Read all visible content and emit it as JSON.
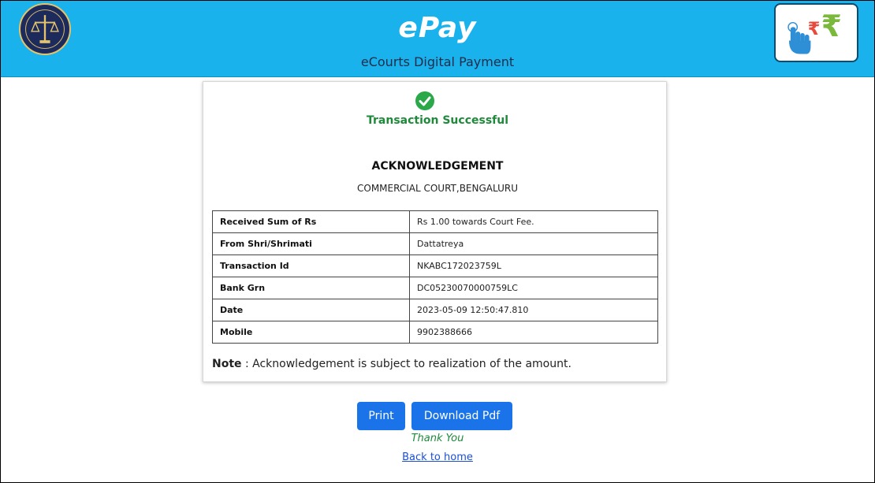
{
  "header": {
    "title": "ePay",
    "subtitle": "eCourts Digital Payment",
    "logo_icon": "court-emblem-icon",
    "pay_icon": "touch-rupee-icon"
  },
  "receipt": {
    "status_icon": "check-circle-icon",
    "status_text": "Transaction Successful",
    "heading": "ACKNOWLEDGEMENT",
    "court": "COMMERCIAL COURT,BENGALURU",
    "rows": [
      {
        "label": "Received Sum of Rs",
        "value": "Rs 1.00 towards Court Fee."
      },
      {
        "label": "From Shri/Shrimati",
        "value": "Dattatreya"
      },
      {
        "label": "Transaction Id",
        "value": "NKABC172023759L"
      },
      {
        "label": "Bank Grn",
        "value": "DC05230070000759LC"
      },
      {
        "label": "Date",
        "value": "2023-05-09 12:50:47.810"
      },
      {
        "label": "Mobile",
        "value": "9902388666"
      }
    ],
    "note_label": "Note",
    "note_text": " : Acknowledgement is subject to realization of the amount."
  },
  "actions": {
    "print_label": "Print",
    "download_label": "Download Pdf",
    "thanks": "Thank You",
    "back_label": "Back to home"
  },
  "colors": {
    "header_bg": "#1ab2ec",
    "success": "#1e8a3a",
    "button": "#1a73e8"
  }
}
